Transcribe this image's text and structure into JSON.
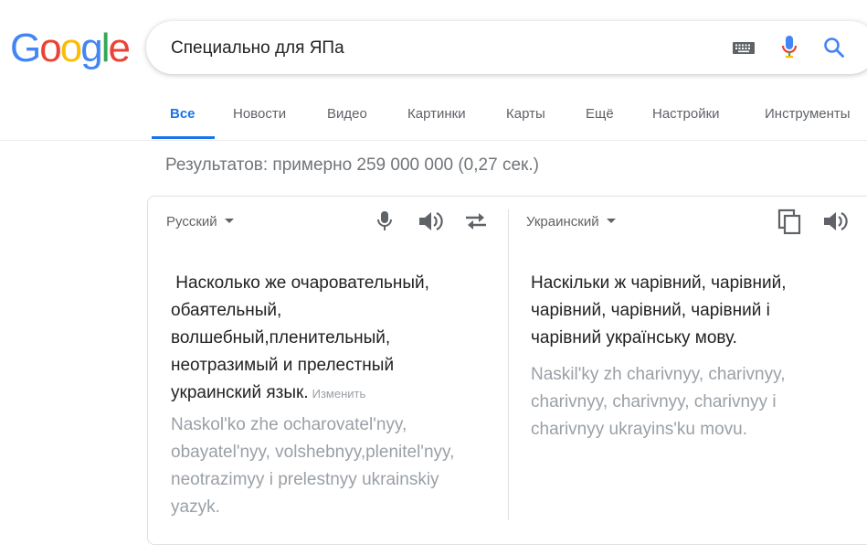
{
  "logo": {
    "text": "Google"
  },
  "colors": {
    "blue": "#4285f4",
    "red": "#ea4335",
    "yellow": "#fbbc05",
    "green": "#34a853",
    "active_tab": "#1a73e8"
  },
  "search": {
    "query": "Специально для ЯПа",
    "icons": [
      "keyboard-icon",
      "microphone-icon",
      "search-icon"
    ]
  },
  "tabs": [
    {
      "label": "Все",
      "active": true
    },
    {
      "label": "Новости"
    },
    {
      "label": "Видео"
    },
    {
      "label": "Картинки"
    },
    {
      "label": "Карты"
    },
    {
      "label": "Ещё"
    },
    {
      "label": "Настройки"
    },
    {
      "label": "Инструменты"
    }
  ],
  "results_stats": "Результатов: примерно 259 000 000 (0,27 сек.)",
  "translator": {
    "source": {
      "language": "Русский",
      "text": " Насколько же очаровательный, обаятельный, волшебный,пленительный, неотразимый и прелестный украинский язык.",
      "edit_label": "Изменить",
      "transliteration": "Naskol'ko zhe ocharovatel'nyy, obayatel'nyy, volshebnyy,plenitel'nyy, neotrazimyy i prelestnyy ukrainskiy yazyk."
    },
    "target": {
      "language": "Украинский",
      "text": "Наскільки ж чарівний, чарівний, чарівний, чарівний, чарівний і чарівний українську мову.",
      "transliteration": "Naskil'ky zh charivnyy, charivnyy, charivnyy, charivnyy, charivnyy i charivnyy ukrayins'ku movu."
    }
  }
}
